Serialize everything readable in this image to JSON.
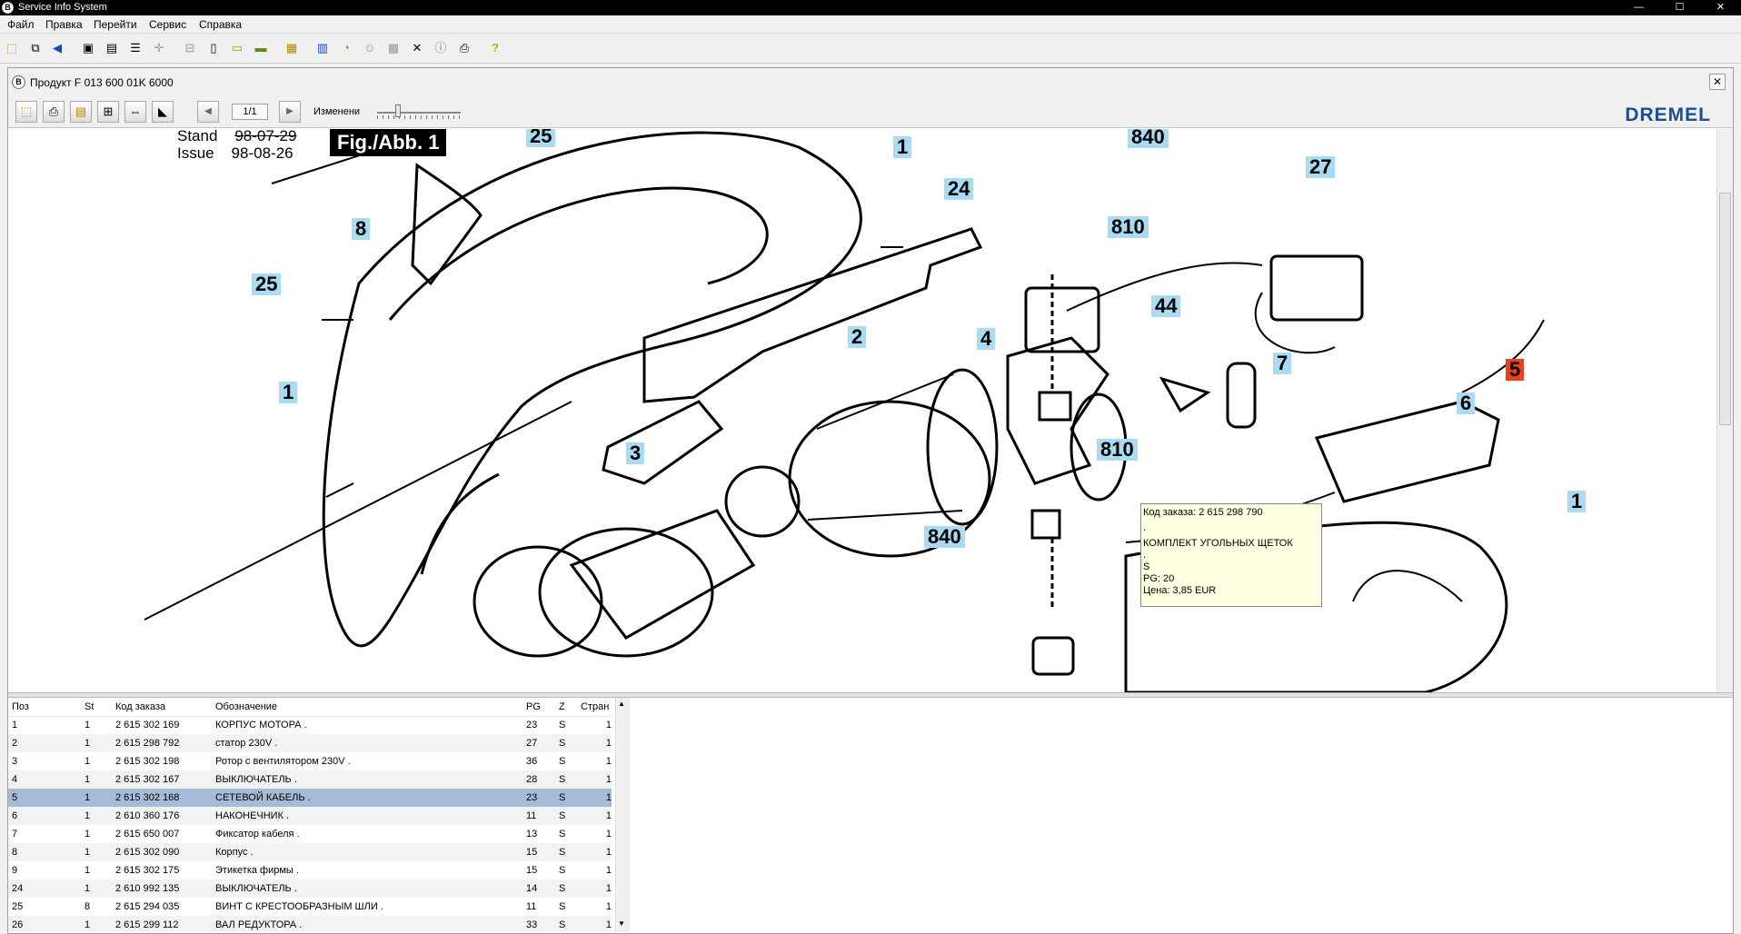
{
  "window": {
    "title": "Service Info System",
    "logo_letter": "B",
    "minimize": "—",
    "maximize": "☐",
    "close": "✕"
  },
  "menu": [
    "Файл",
    "Правка",
    "Перейти",
    "Сервис",
    "Справка"
  ],
  "doc": {
    "title": "Продукт F 013 600 01K   6000",
    "close": "✕",
    "page": "1/1",
    "izm_label": "Изменени",
    "brand": "DREMEL"
  },
  "drawing": {
    "stand_label": "Stand",
    "issue_label": "Issue",
    "stand_date": "98-07-29",
    "issue_date": "98-08-26",
    "fig": "Fig./Abb. 1",
    "callouts": [
      "25",
      "1",
      "840",
      "27",
      "8",
      "24",
      "810",
      "25",
      "44",
      "2",
      "4",
      "7",
      "5",
      "1",
      "6",
      "3",
      "810",
      "1",
      "840"
    ]
  },
  "tooltip": {
    "line1": "Код заказа: 2 615 298 790",
    "line2": ".",
    "line3": "КОМПЛЕКТ УГОЛЬНЫХ ЩЕТОК",
    "line4": ".",
    "line5": "S",
    "line6": "PG: 20",
    "line7": "Цена: 3,85 EUR"
  },
  "parts": {
    "headers": [
      "Поз",
      "St",
      "Код заказа",
      "Обозначение",
      "PG",
      "Z",
      "Стран"
    ],
    "rows": [
      [
        "1",
        "1",
        "2 615 302 169",
        "КОРПУС МОТОРА   .",
        "23",
        "S",
        "1"
      ],
      [
        "2",
        "1",
        "2 615 298 792",
        "статор  230V .",
        "27",
        "S",
        "1"
      ],
      [
        "3",
        "1",
        "2 615 302 198",
        "Ротор с вентилятором  230V .",
        "36",
        "S",
        "1"
      ],
      [
        "4",
        "1",
        "2 615 302 167",
        "ВЫКЛЮЧАТЕЛЬ   .",
        "28",
        "S",
        "1"
      ],
      [
        "5",
        "1",
        "2 615 302 168",
        "СЕТЕВОЙ КАБЕЛЬ   .",
        "23",
        "S",
        "1"
      ],
      [
        "6",
        "1",
        "2 610 360 176",
        "НАКОНЕЧНИК   .",
        "11",
        "S",
        "1"
      ],
      [
        "7",
        "1",
        "2 615 650 007",
        "Фиксатор кабеля   .",
        "13",
        "S",
        "1"
      ],
      [
        "8",
        "1",
        "2 615 302 090",
        "Корпус   .",
        "15",
        "S",
        "1"
      ],
      [
        "9",
        "1",
        "2 615 302 175",
        "Этикетка фирмы   .",
        "15",
        "S",
        "1"
      ],
      [
        "24",
        "1",
        "2 610 992 135",
        "ВЫКЛЮЧАТЕЛЬ   .",
        "14",
        "S",
        "1"
      ],
      [
        "25",
        "8",
        "2 615 294 035",
        "ВИНТ С КРЕСТООБРАЗНЫМ ШЛИ   .",
        "11",
        "S",
        "1"
      ],
      [
        "26",
        "1",
        "2 615 299 112",
        "ВАЛ РЕДУКТОРА   .",
        "33",
        "S",
        "1"
      ]
    ],
    "selected_index": 4
  }
}
